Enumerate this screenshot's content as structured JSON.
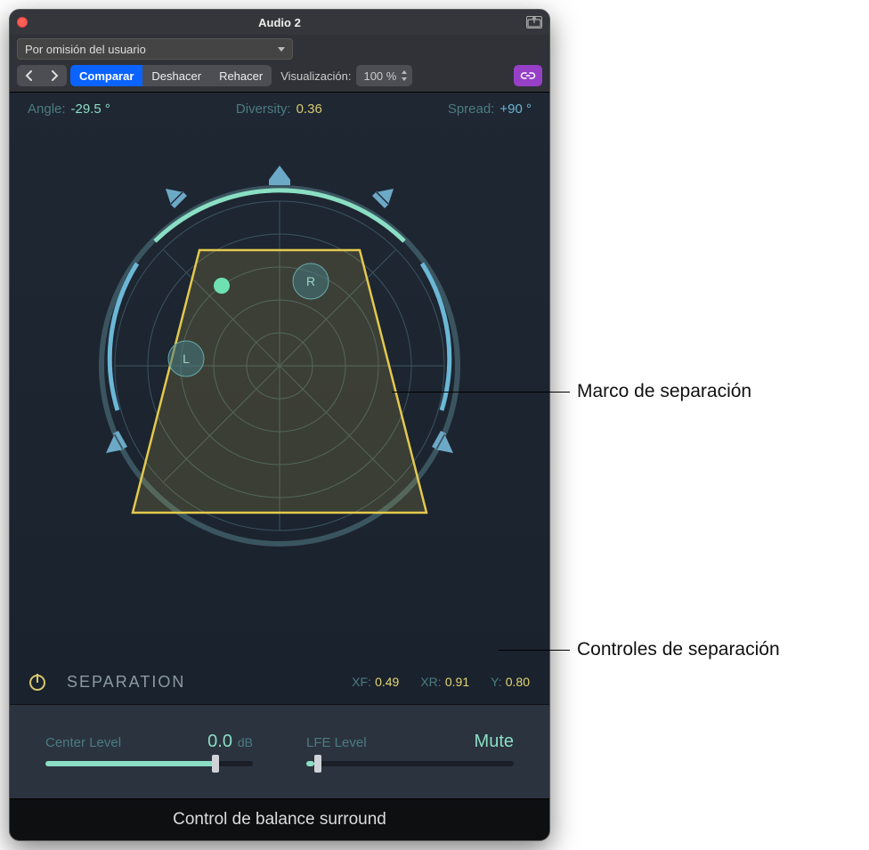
{
  "title": "Audio 2",
  "preset": "Por omisión del usuario",
  "toolbar": {
    "compare": "Comparar",
    "undo": "Deshacer",
    "redo": "Rehacer",
    "view_label": "Visualización:",
    "zoom": "100 %"
  },
  "readouts": {
    "angle_label": "Angle:",
    "angle_value": "-29.5 °",
    "diversity_label": "Diversity:",
    "diversity_value": "0.36",
    "spread_label": "Spread:",
    "spread_value": "+90 °"
  },
  "separation": {
    "title": "SEPARATION",
    "xf_label": "XF:",
    "xf_value": "0.49",
    "xr_label": "XR:",
    "xr_value": "0.91",
    "y_label": "Y:",
    "y_value": "0.80"
  },
  "sliders": {
    "center_label": "Center Level",
    "center_value": "0.0",
    "center_unit": "dB",
    "center_fill_pct": 82,
    "lfe_label": "LFE Level",
    "lfe_mute": "Mute",
    "lfe_fill_pct": 4
  },
  "radar": {
    "left_label": "L",
    "right_label": "R"
  },
  "footer": "Control de balance surround",
  "callouts": {
    "frame": "Marco de separación",
    "controls": "Controles de separación"
  }
}
